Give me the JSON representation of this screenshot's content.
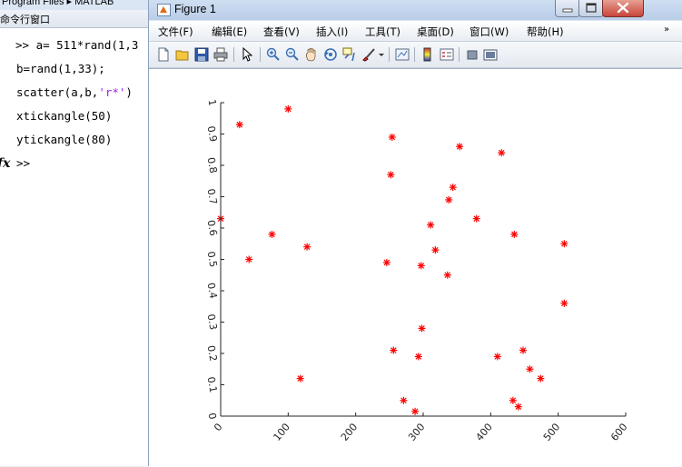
{
  "command_window": {
    "path_text": "Program Files ▸ MATLAB",
    "title": "命令行窗口",
    "lines": [
      {
        "prompt": ">> ",
        "code": "a= 511*rand(1,3"
      },
      {
        "prompt": "",
        "code": "b=rand(1,33);"
      },
      {
        "prompt": "",
        "code_before": "scatter(a,b,",
        "code_string": "'r*'",
        "code_after": ")"
      },
      {
        "prompt": "",
        "code": "xtickangle(50)"
      },
      {
        "prompt": "",
        "code": "ytickangle(80)"
      }
    ],
    "fx_symbol": "fx",
    "next_prompt": ">>"
  },
  "figure": {
    "title": "Figure 1",
    "menu": [
      "文件(F)",
      "编辑(E)",
      "查看(V)",
      "插入(I)",
      "工具(T)",
      "桌面(D)",
      "窗口(W)",
      "帮助(H)"
    ],
    "menu_overflow": "»",
    "toolbar_icons": [
      "new-figure-icon",
      "open-file-icon",
      "save-icon",
      "print-icon",
      "pointer-icon",
      "zoom-in-icon",
      "zoom-out-icon",
      "pan-icon",
      "rotate-3d-icon",
      "data-cursor-icon",
      "brush-icon",
      "dropdown-arrow-icon",
      "link-plot-icon",
      "colorbar-icon",
      "legend-icon",
      "hide-plot-tools-icon",
      "show-plot-tools-icon"
    ]
  },
  "chart_data": {
    "type": "scatter",
    "marker": "*",
    "marker_color": "#ff0000",
    "xlim": [
      0,
      600
    ],
    "ylim": [
      0,
      1
    ],
    "xticks": [
      0,
      100,
      200,
      300,
      400,
      500,
      600
    ],
    "xtick_labels": [
      "0",
      "100",
      "200",
      "300",
      "400",
      "500",
      "600"
    ],
    "yticks": [
      0,
      0.1,
      0.2,
      0.3,
      0.4,
      0.5,
      0.6,
      0.7,
      0.8,
      0.9,
      1
    ],
    "ytick_labels": [
      "0",
      "0.1",
      "0.2",
      "0.3",
      "0.4",
      "0.5",
      "0.6",
      "0.7",
      "0.8",
      "0.9",
      "1"
    ],
    "xtick_angle": 50,
    "ytick_angle": 80,
    "points": [
      {
        "x": 0,
        "y": 0.63
      },
      {
        "x": 28,
        "y": 0.93
      },
      {
        "x": 42,
        "y": 0.5
      },
      {
        "x": 76,
        "y": 0.58
      },
      {
        "x": 100,
        "y": 0.98
      },
      {
        "x": 118,
        "y": 0.12
      },
      {
        "x": 128,
        "y": 0.54
      },
      {
        "x": 246,
        "y": 0.49
      },
      {
        "x": 252,
        "y": 0.77
      },
      {
        "x": 254,
        "y": 0.89
      },
      {
        "x": 256,
        "y": 0.21
      },
      {
        "x": 271,
        "y": 0.05
      },
      {
        "x": 288,
        "y": 0.015
      },
      {
        "x": 293,
        "y": 0.19
      },
      {
        "x": 297,
        "y": 0.48
      },
      {
        "x": 298,
        "y": 0.28
      },
      {
        "x": 311,
        "y": 0.61
      },
      {
        "x": 318,
        "y": 0.53
      },
      {
        "x": 336,
        "y": 0.45
      },
      {
        "x": 338,
        "y": 0.69
      },
      {
        "x": 344,
        "y": 0.73
      },
      {
        "x": 354,
        "y": 0.86
      },
      {
        "x": 379,
        "y": 0.63
      },
      {
        "x": 410,
        "y": 0.19
      },
      {
        "x": 416,
        "y": 0.84
      },
      {
        "x": 433,
        "y": 0.05
      },
      {
        "x": 435,
        "y": 0.58
      },
      {
        "x": 441,
        "y": 0.03
      },
      {
        "x": 448,
        "y": 0.21
      },
      {
        "x": 458,
        "y": 0.15
      },
      {
        "x": 474,
        "y": 0.12
      },
      {
        "x": 509,
        "y": 0.55
      },
      {
        "x": 509,
        "y": 0.36
      }
    ]
  }
}
